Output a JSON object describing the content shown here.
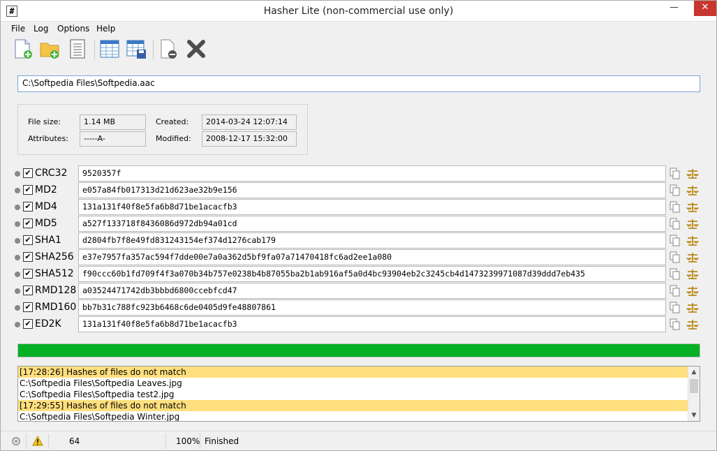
{
  "window": {
    "title": "Hasher Lite (non-commercial use only)",
    "icon_text": "#"
  },
  "menu": {
    "items": [
      "File",
      "Log",
      "Options",
      "Help"
    ]
  },
  "toolbar": {
    "buttons": [
      "add-file-icon",
      "add-folder-icon",
      "document-icon",
      "table-icon",
      "save-table-icon",
      "remove-file-icon",
      "clear-icon"
    ]
  },
  "path": {
    "value": "C:\\Softpedia Files\\Softpedia.aac"
  },
  "info": {
    "file_size_label": "File size:",
    "file_size": "1.14 MB",
    "attributes_label": "Attributes:",
    "attributes": "-----A-",
    "created_label": "Created:",
    "created": "2014-03-24 12:07:14",
    "modified_label": "Modified:",
    "modified": "2008-12-17 15:32:00"
  },
  "hashes": [
    {
      "name": "CRC32",
      "checked": true,
      "value": "9520357f"
    },
    {
      "name": "MD2",
      "checked": true,
      "value": "e057a84fb017313d21d623ae32b9e156"
    },
    {
      "name": "MD4",
      "checked": true,
      "value": "131a131f40f8e5fa6b8d71be1acacfb3"
    },
    {
      "name": "MD5",
      "checked": true,
      "value": "a527f133718f8436086d972db94a01cd"
    },
    {
      "name": "SHA1",
      "checked": true,
      "value": "d2804fb7f8e49fd831243154ef374d1276cab179"
    },
    {
      "name": "SHA256",
      "checked": true,
      "value": "e37e7957fa357ac594f7dde00e7a0a362d5bf9fa07a71470418fc6ad2ee1a080"
    },
    {
      "name": "SHA512",
      "checked": true,
      "value": "f90ccc60b1fd709f4f3a070b34b757e0238b4b87055ba2b1ab916af5a0d4bc93904eb2c3245cb4d1473239971087d39ddd7eb435"
    },
    {
      "name": "RMD128",
      "checked": true,
      "value": "a03524471742db3bbbd6800ccebfcd47"
    },
    {
      "name": "RMD160",
      "checked": true,
      "value": "bb7b31c788fc923b6468c6de0405d9fe48807861"
    },
    {
      "name": "ED2K",
      "checked": true,
      "value": "131a131f40f8e5fa6b8d71be1acacfb3"
    }
  ],
  "progress": {
    "percent": 100,
    "color": "#06b025"
  },
  "log": {
    "lines": [
      {
        "text": "[17:28:26] Hashes of files do not match",
        "warn": true
      },
      {
        "text": "C:\\Softpedia Files\\Softpedia Leaves.jpg",
        "warn": false
      },
      {
        "text": "C:\\Softpedia Files\\Softpedia test2.jpg",
        "warn": false
      },
      {
        "text": "[17:29:55] Hashes of files do not match",
        "warn": true
      },
      {
        "text": "C:\\Softpedia Files\\Softpedia Winter.jpg",
        "warn": false
      }
    ]
  },
  "status": {
    "count": "64",
    "percent": "100%",
    "state": "Finished"
  },
  "colors": {
    "warn_highlight": "#ffdf7e",
    "accent": "#7aa7d6"
  }
}
